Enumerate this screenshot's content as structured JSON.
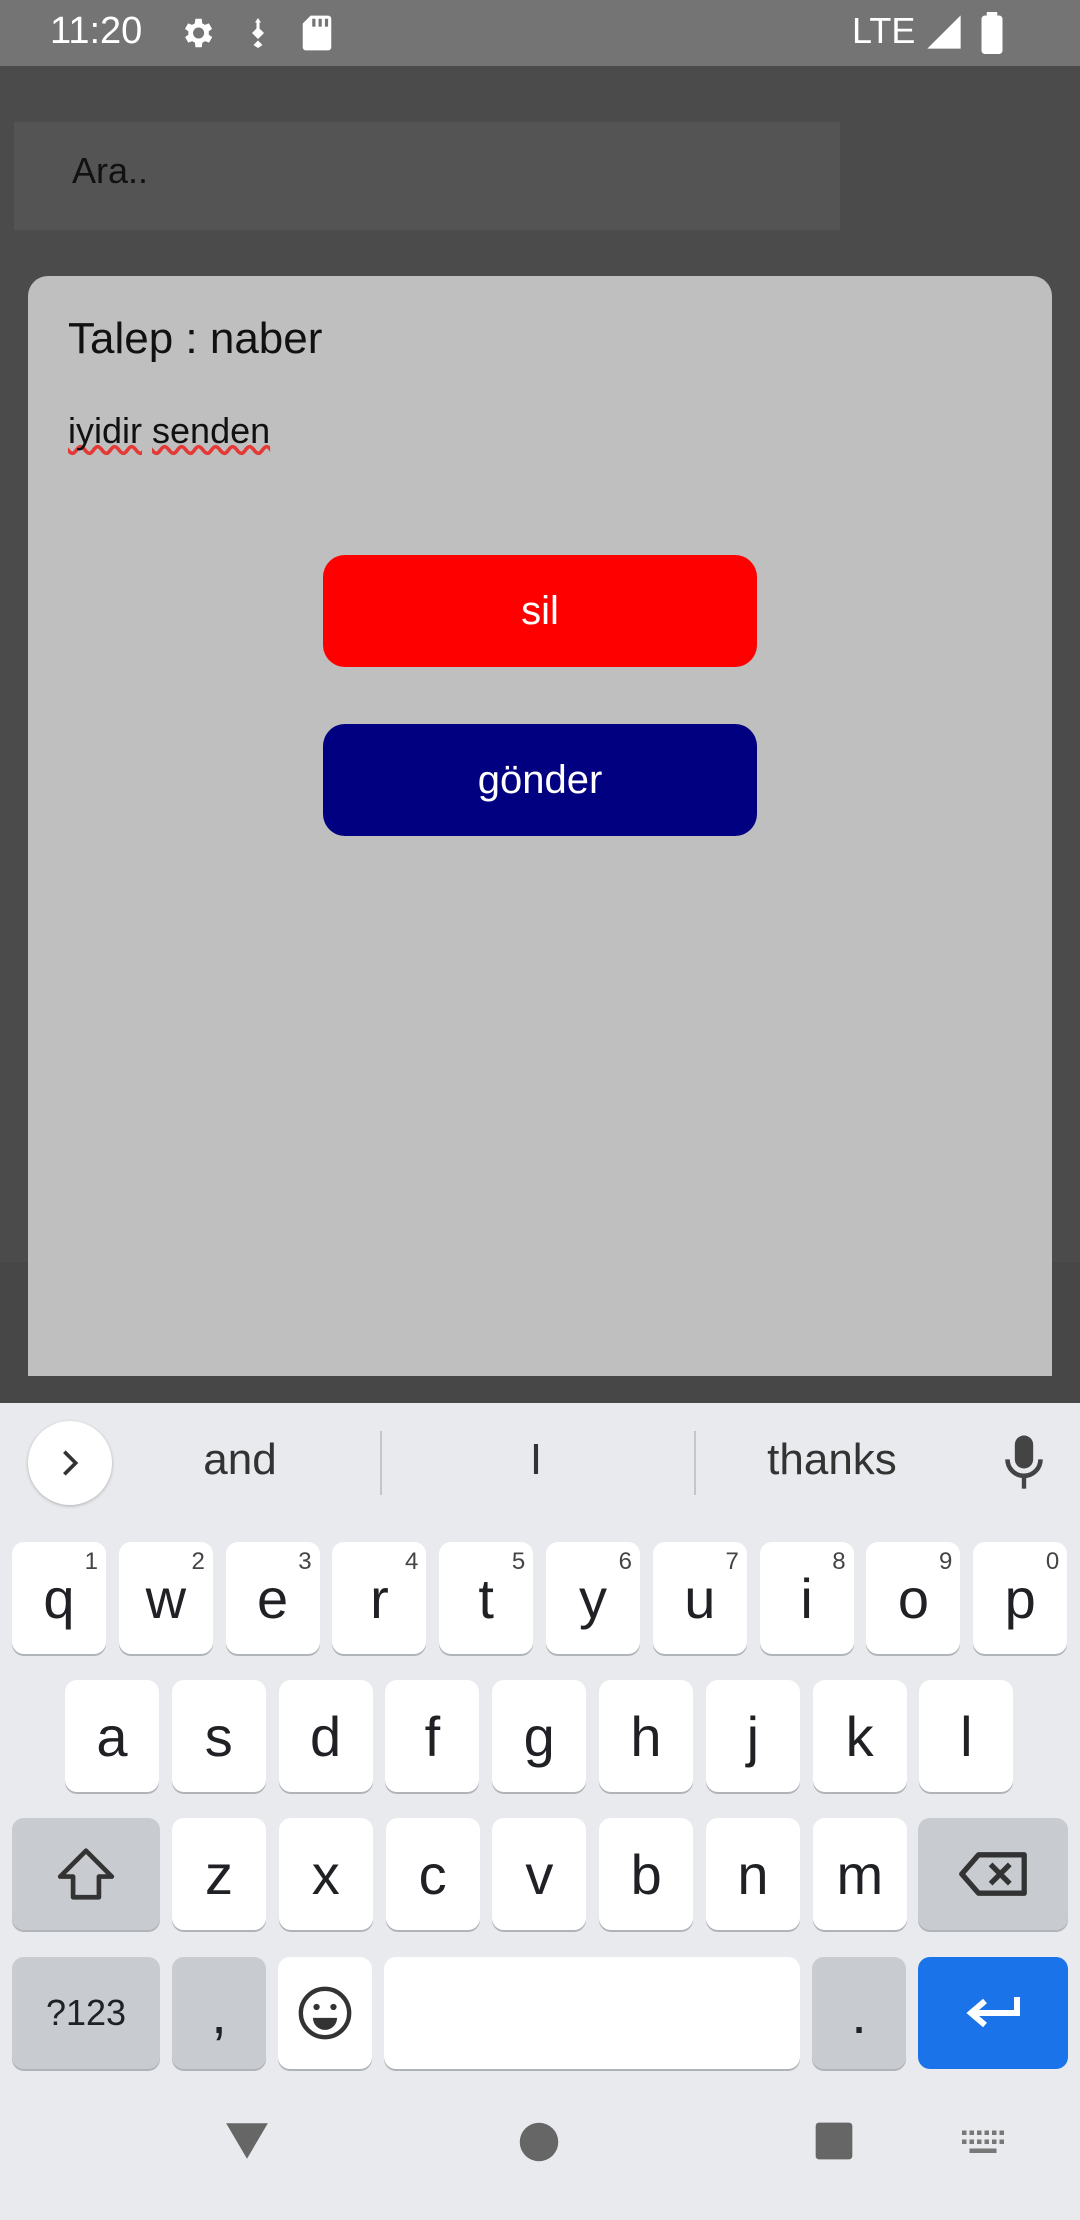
{
  "status_bar": {
    "time": "11:20",
    "network": "LTE"
  },
  "search": {
    "placeholder": "Ara.."
  },
  "dialog": {
    "title": "Talep : naber",
    "message_words": [
      "iyidir",
      "senden"
    ],
    "delete_label": "sil",
    "send_label": "gönder",
    "delete_color": "#ff0000",
    "send_color": "#000080"
  },
  "keyboard": {
    "suggestions": [
      "and",
      "I",
      "thanks"
    ],
    "row1": [
      [
        "q",
        "1"
      ],
      [
        "w",
        "2"
      ],
      [
        "e",
        "3"
      ],
      [
        "r",
        "4"
      ],
      [
        "t",
        "5"
      ],
      [
        "y",
        "6"
      ],
      [
        "u",
        "7"
      ],
      [
        "i",
        "8"
      ],
      [
        "o",
        "9"
      ],
      [
        "p",
        "0"
      ]
    ],
    "row2": [
      "a",
      "s",
      "d",
      "f",
      "g",
      "h",
      "j",
      "k",
      "l"
    ],
    "row3": [
      "z",
      "x",
      "c",
      "v",
      "b",
      "n",
      "m"
    ],
    "symbols_label": "?123",
    "comma": ",",
    "period": ".",
    "enter_color": "#1a73e8"
  }
}
